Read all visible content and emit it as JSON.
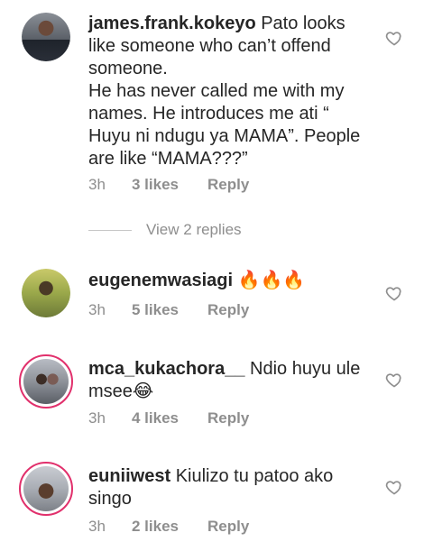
{
  "comments": [
    {
      "username": "james.frank.kokeyo",
      "text": " Pato looks like someone who can’t offend someone.\nHe has never called me with my names. He introduces me ati “ Huyu ni ndugu ya MAMA”. People are like “MAMA???”",
      "time": "3h",
      "likes": "3 likes",
      "reply": "Reply"
    },
    {
      "username": "eugenemwasiagi",
      "text": " 🔥🔥🔥",
      "time": "3h",
      "likes": "5 likes",
      "reply": "Reply"
    },
    {
      "username": "mca_kukachora__",
      "text": " Ndio huyu ule msee😂",
      "time": "3h",
      "likes": "4 likes",
      "reply": "Reply"
    },
    {
      "username": "euniiwest",
      "text": " Kiulizo tu patoo ako singo",
      "time": "3h",
      "likes": "2 likes",
      "reply": "Reply"
    }
  ],
  "view_replies": "View 2 replies",
  "colors": {
    "accent_ring": "#e1306c",
    "meta_gray": "#8e8e8e",
    "text": "#262626"
  }
}
